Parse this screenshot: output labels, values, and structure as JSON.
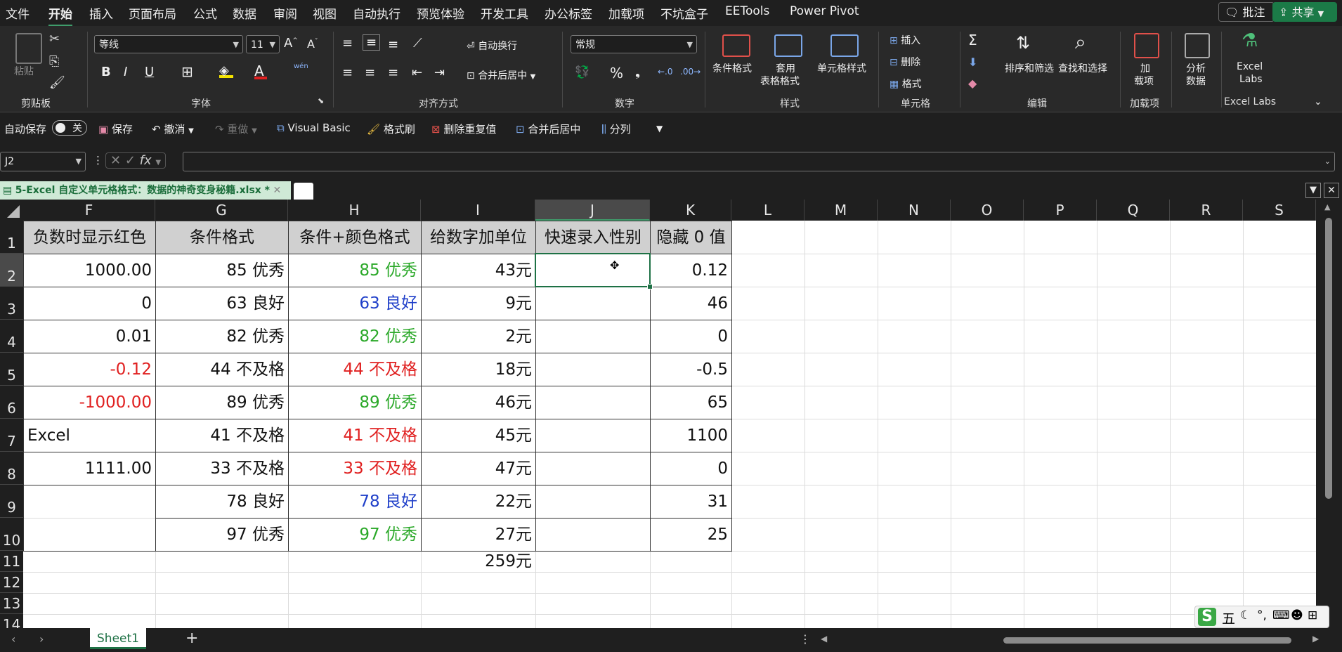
{
  "menubar": {
    "items": [
      "文件",
      "开始",
      "插入",
      "页面布局",
      "公式",
      "数据",
      "审阅",
      "视图",
      "自动执行",
      "预览体验",
      "开发工具",
      "办公标签",
      "加载项",
      "不坑盒子",
      "EETools",
      "Power Pivot"
    ],
    "active_index": 1,
    "comment_btn": "批注",
    "share_btn": "共享"
  },
  "ribbon": {
    "clipboard": {
      "paste": "粘贴",
      "label": "剪贴板"
    },
    "font": {
      "name": "等线",
      "size": "11",
      "label": "字体",
      "bold": "B",
      "italic": "I",
      "underline": "U",
      "wen": "wén"
    },
    "align": {
      "wrap": "自动换行",
      "merge": "合并后居中",
      "label": "对齐方式"
    },
    "number": {
      "format": "常规",
      "percent": "%",
      "label": "数字"
    },
    "styles": {
      "cond": "条件格式",
      "table1": "套用",
      "table2": "表格格式",
      "cellstyle": "单元格样式",
      "label": "样式"
    },
    "cells": {
      "insert": "插入",
      "delete": "删除",
      "format": "格式",
      "label": "单元格"
    },
    "editing": {
      "sum": "Σ",
      "sort": "排序和筛选",
      "find": "查找和选择",
      "label": "编辑"
    },
    "addins": {
      "addin1": "加",
      "addin2": "载项",
      "label": "加载项"
    },
    "analyze": {
      "l1": "分析",
      "l2": "数据"
    },
    "labs": {
      "l1": "Excel",
      "l2": "Labs",
      "label": "Excel Labs"
    }
  },
  "qat": {
    "autosave": "自动保存",
    "toggle": "关",
    "save": "保存",
    "undo": "撤消",
    "redo": "重做",
    "vb": "Visual Basic",
    "painter": "格式刷",
    "dedupe": "删除重复值",
    "merge": "合并后居中",
    "split": "分列"
  },
  "formula_bar": {
    "name_box": "J2",
    "fx": "fx",
    "formula": ""
  },
  "document": {
    "tab_title": "5-Excel 自定义单元格格式：数据的神奇变身秘籍.xlsx *"
  },
  "sheet": {
    "columns": [
      "F",
      "G",
      "H",
      "I",
      "J",
      "K",
      "L",
      "M",
      "N",
      "O",
      "P",
      "Q",
      "R",
      "S"
    ],
    "selected_column": "J",
    "rows": [
      "1",
      "2",
      "3",
      "4",
      "5",
      "6",
      "7",
      "8",
      "9",
      "10",
      "11",
      "12",
      "13",
      "14"
    ],
    "selected_row": "2",
    "headers": [
      "负数时显示红色",
      "条件格式",
      "条件+颜色格式",
      "给数字加单位",
      "快速录入性别",
      "隐藏 0 值"
    ],
    "data": [
      {
        "F": "1000.00",
        "G": "85 优秀",
        "H": "85 优秀",
        "I": "43元",
        "K": "0.12"
      },
      {
        "F": "0",
        "G": "63 良好",
        "H": "63 良好",
        "I": "9元",
        "K": "46"
      },
      {
        "F": "0.01",
        "G": "82 优秀",
        "H": "82 优秀",
        "I": "2元",
        "K": "0"
      },
      {
        "F": "-0.12",
        "G": "44 不及格",
        "H": "44 不及格",
        "I": "18元",
        "K": "-0.5"
      },
      {
        "F": "-1000.00",
        "G": "89 优秀",
        "H": "89 优秀",
        "I": "46元",
        "K": "65"
      },
      {
        "F": "Excel",
        "G": "41 不及格",
        "H": "41 不及格",
        "I": "45元",
        "K": "1100"
      },
      {
        "F": "1111.00",
        "G": "33 不及格",
        "H": "33 不及格",
        "I": "47元",
        "K": "0"
      },
      {
        "F": "",
        "G": "78 良好",
        "H": "78 良好",
        "I": "22元",
        "K": "31"
      },
      {
        "F": "",
        "G": "97 优秀",
        "H": "97 优秀",
        "I": "27元",
        "K": "25"
      }
    ],
    "total_I": "259元",
    "colors": {
      "green": "#2aa828",
      "blue": "#1f3fc9",
      "red": "#e02020",
      "black": "#111111"
    }
  },
  "bottom": {
    "sheet_tab": "Sheet1",
    "add": "+"
  },
  "ime": {
    "logo": "S",
    "mode": "五"
  }
}
